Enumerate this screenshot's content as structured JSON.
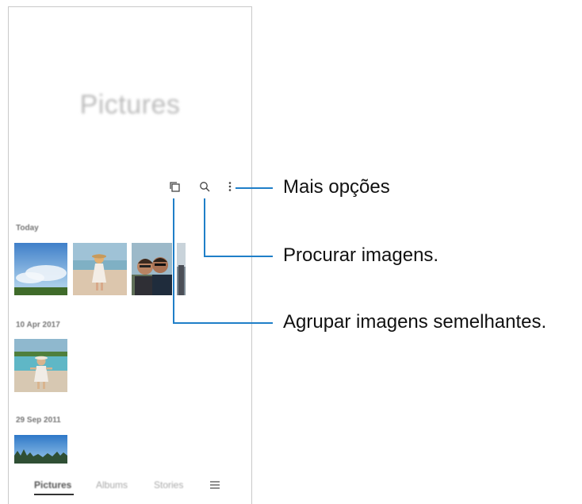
{
  "screen": {
    "title": "Pictures",
    "toolbar": {
      "icons": [
        "group-similar-icon",
        "search-icon",
        "more-options-icon"
      ]
    },
    "sections": [
      {
        "label": "Today",
        "photos": [
          "sky-landscape",
          "beach-girl",
          "couple-selfie",
          "partial-photo"
        ]
      },
      {
        "label": "10 Apr 2017",
        "photos": [
          "beach-child"
        ]
      },
      {
        "label": "29 Sep 2011",
        "photos": [
          "forest-sky"
        ]
      }
    ],
    "bottom_nav": {
      "pictures": "Pictures",
      "albums": "Albums",
      "stories": "Stories",
      "menu_icon": "hamburger-icon"
    }
  },
  "callouts": {
    "more_options": "Mais opções",
    "search": "Procurar imagens.",
    "group": "Agrupar imagens semelhantes."
  },
  "colors": {
    "callout_line": "#1f7fc8"
  }
}
